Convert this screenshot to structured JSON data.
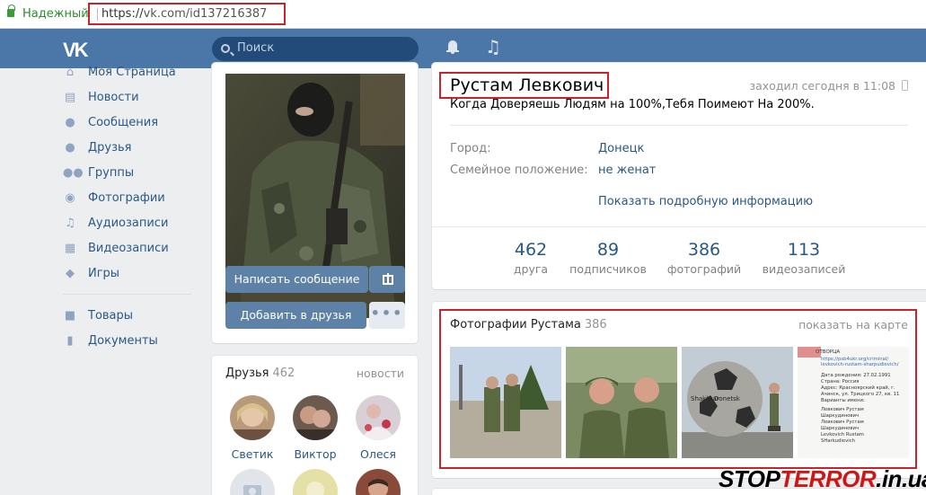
{
  "browser": {
    "secure_label": "Надежный",
    "url_scheme": "https://",
    "url_rest": "vk.com/id137216387"
  },
  "header": {
    "logo": "VK",
    "search_placeholder": "Поиск",
    "icons": [
      "bell-icon",
      "music-icon"
    ]
  },
  "sidebar": {
    "items": [
      {
        "label": "Моя Страница",
        "icon": "home-icon"
      },
      {
        "label": "Новости",
        "icon": "news-icon"
      },
      {
        "label": "Сообщения",
        "icon": "messages-icon"
      },
      {
        "label": "Друзья",
        "icon": "friend-icon"
      },
      {
        "label": "Группы",
        "icon": "groups-icon"
      },
      {
        "label": "Фотографии",
        "icon": "camera-icon"
      },
      {
        "label": "Аудиозаписи",
        "icon": "music-note-icon"
      },
      {
        "label": "Видеозаписи",
        "icon": "video-icon"
      },
      {
        "label": "Игры",
        "icon": "gamepad-icon"
      },
      {
        "label": "Товары",
        "icon": "bag-icon"
      },
      {
        "label": "Документы",
        "icon": "document-icon"
      }
    ]
  },
  "profile": {
    "name": "Рустам Левкович",
    "last_seen": "заходил сегодня в 11:08",
    "status": "Когда Доверяешь Людям на 100%,Тебя Поимеют На 200%.",
    "fields": [
      {
        "label": "Город:",
        "value": "Донецк"
      },
      {
        "label": "Семейное положение:",
        "value": "не женат"
      }
    ],
    "show_more": "Показать подробную информацию",
    "stats": [
      {
        "value": "462",
        "label": "друга"
      },
      {
        "value": "89",
        "label": "подписчиков"
      },
      {
        "value": "386",
        "label": "фотографий"
      },
      {
        "value": "113",
        "label": "видеозаписей"
      }
    ]
  },
  "actions": {
    "message_button": "Написать сообщение",
    "add_friend_button": "Добавить в друзья",
    "more": "•••"
  },
  "friends": {
    "title": "Друзья",
    "count": "462",
    "news_link": "новости",
    "items": [
      {
        "name": "Светик"
      },
      {
        "name": "Виктор"
      },
      {
        "name": "Олеся"
      }
    ]
  },
  "photos": {
    "title": "Фотографии Рустама",
    "count": "386",
    "map_link": "показать на карте",
    "screenshot_text": {
      "heading": "ОТВОРЦА",
      "link1": "https://psb4ukr.org/criminal/",
      "link2": "levkovich-rustam-sharpudievich/",
      "birth": "Дата рождения: 27.02.1991",
      "country": "Страна: Россия",
      "address1": "Адрес: Красноярский край, г.",
      "address2": "Ачинск, ул. Трицкого 27, кв. 11",
      "variants": "Варианты имени:",
      "v1": "Левкович Рустам",
      "v2": "Шаркудинович",
      "v3": "Левкович Рустам",
      "v4": "Шаркудинович",
      "v5": "Levkovich Rustam",
      "v6": "SHarkudievich"
    },
    "ball_text": {
      "left": "Shakhtar",
      "right": "Donetsk"
    }
  },
  "watermark": {
    "stop": "STOP",
    "terror": "TERROR",
    "domain": ".in.ua"
  }
}
